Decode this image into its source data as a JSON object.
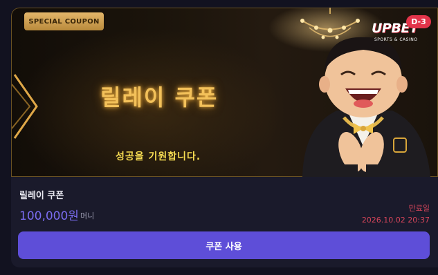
{
  "banner": {
    "badge": "SPECIAL COUPON",
    "title": "릴레이 쿠폰",
    "subtitle": "성공을 기원합니다.",
    "logo_main": "UPBET",
    "logo_sub": "SPORTS & CASINO",
    "dday": "D-3"
  },
  "coupon": {
    "name": "릴레이 쿠폰",
    "amount": "100,000원",
    "unit": "머니",
    "expire_label": "만료일",
    "expire_date": "2026.10.02 20:37",
    "use_label": "쿠폰 사용"
  },
  "colors": {
    "accent": "#5e4ed8",
    "amount": "#7a6cf0",
    "expire": "#d6455a",
    "gold": "#f3c15a"
  },
  "icons": {
    "chevron": "chevron-right-icon",
    "mascot": "mascot-illustration"
  }
}
